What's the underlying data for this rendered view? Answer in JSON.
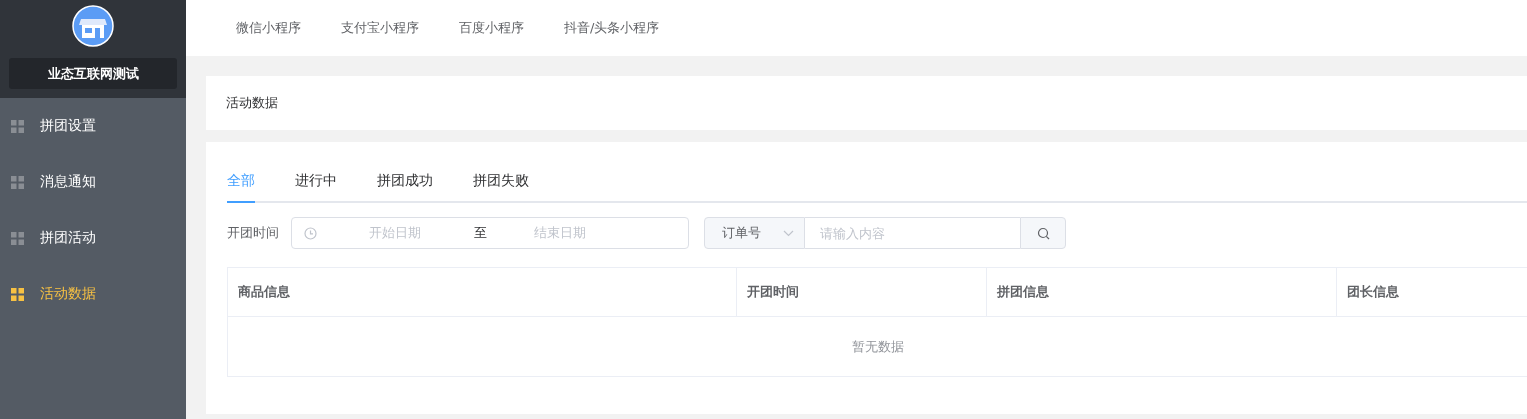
{
  "sidebar": {
    "shop_name": "业态互联网测试",
    "items": [
      {
        "label": "拼团设置",
        "selected": false
      },
      {
        "label": "消息通知",
        "selected": false
      },
      {
        "label": "拼团活动",
        "selected": false
      },
      {
        "label": "活动数据",
        "selected": true
      }
    ]
  },
  "top_nav": [
    "微信小程序",
    "支付宝小程序",
    "百度小程序",
    "抖音/头条小程序"
  ],
  "page_title": "活动数据",
  "tabs": [
    {
      "label": "全部",
      "selected": true
    },
    {
      "label": "进行中",
      "selected": false
    },
    {
      "label": "拼团成功",
      "selected": false
    },
    {
      "label": "拼团失败",
      "selected": false
    }
  ],
  "filter": {
    "label": "开团时间",
    "start_placeholder": "开始日期",
    "separator": "至",
    "end_placeholder": "结束日期",
    "search_type": "订单号",
    "search_placeholder": "请输入内容"
  },
  "table": {
    "columns": [
      "商品信息",
      "开团时间",
      "拼团信息",
      "团长信息"
    ],
    "empty_text": "暂无数据"
  }
}
